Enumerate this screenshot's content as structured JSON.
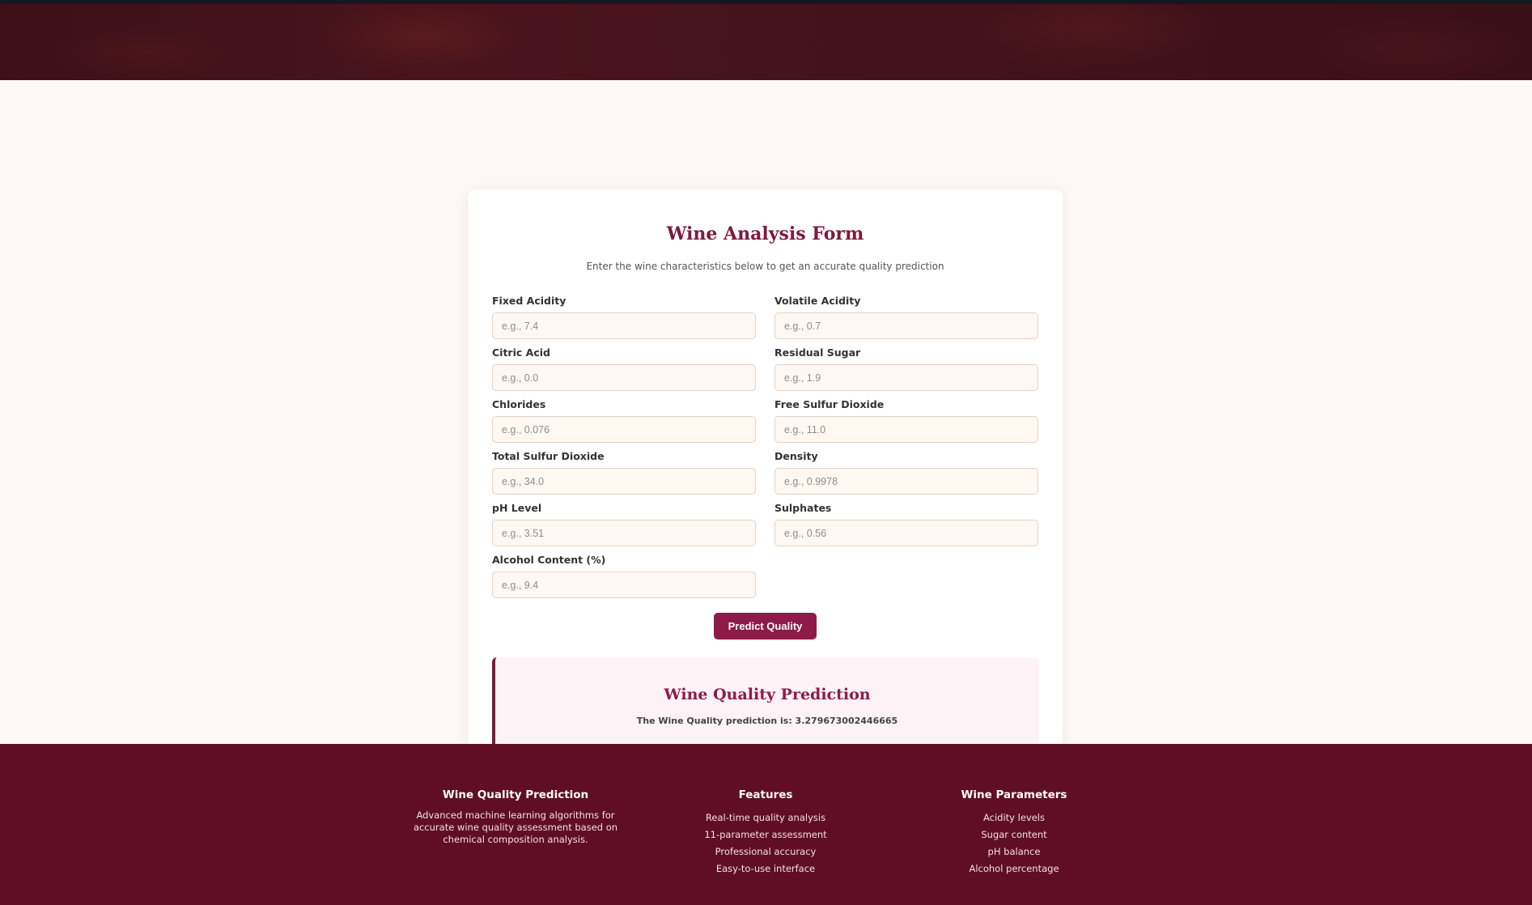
{
  "form": {
    "title": "Wine Analysis Form",
    "subtitle": "Enter the wine characteristics below to get an accurate quality prediction",
    "fields": [
      {
        "label": "Fixed Acidity",
        "placeholder": "e.g., 7.4",
        "value": ""
      },
      {
        "label": "Volatile Acidity",
        "placeholder": "e.g., 0.7",
        "value": ""
      },
      {
        "label": "Citric Acid",
        "placeholder": "e.g., 0.0",
        "value": ""
      },
      {
        "label": "Residual Sugar",
        "placeholder": "e.g., 1.9",
        "value": ""
      },
      {
        "label": "Chlorides",
        "placeholder": "e.g., 0.076",
        "value": ""
      },
      {
        "label": "Free Sulfur Dioxide",
        "placeholder": "e.g., 11.0",
        "value": ""
      },
      {
        "label": "Total Sulfur Dioxide",
        "placeholder": "e.g., 34.0",
        "value": ""
      },
      {
        "label": "Density",
        "placeholder": "e.g., 0.9978",
        "value": ""
      },
      {
        "label": "pH Level",
        "placeholder": "e.g., 3.51",
        "value": ""
      },
      {
        "label": "Sulphates",
        "placeholder": "e.g., 0.56",
        "value": ""
      },
      {
        "label": "Alcohol Content (%)",
        "placeholder": "e.g., 9.4",
        "value": ""
      }
    ],
    "submit_label": "Predict Quality"
  },
  "result": {
    "title": "Wine Quality Prediction",
    "text": "The Wine Quality prediction is: 3.279673002446665"
  },
  "footer": {
    "columns": [
      {
        "heading": "Wine Quality Prediction",
        "description": "Advanced machine learning algorithms for accurate wine quality assessment based on chemical composition analysis."
      },
      {
        "heading": "Features",
        "items": [
          "Real-time quality analysis",
          "11-parameter assessment",
          "Professional accuracy",
          "Easy-to-use interface"
        ]
      },
      {
        "heading": "Wine Parameters",
        "items": [
          "Acidity levels",
          "Sugar content",
          "pH balance",
          "Alcohol percentage"
        ]
      }
    ]
  },
  "colors": {
    "accent": "#7d1a3e",
    "button": "#8e1a4a",
    "footer_bg": "#600e26",
    "hero_bg": "#3d1018",
    "page_bg": "#fdf8f5",
    "input_bg": "#fff8f2"
  }
}
